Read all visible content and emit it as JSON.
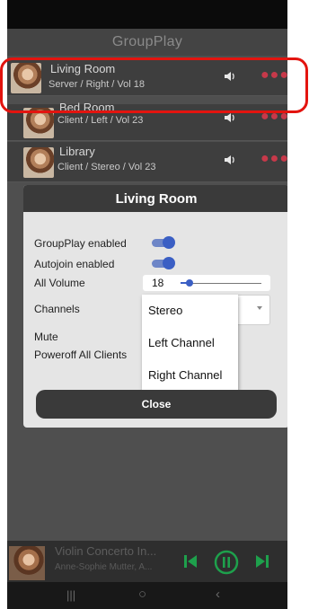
{
  "app": {
    "title": "GroupPlay"
  },
  "rooms": [
    {
      "name": "Living Room",
      "detail": "Server / Right / Vol 18"
    },
    {
      "name": "Bed Room",
      "detail": "Client / Left / Vol 23"
    },
    {
      "name": "Library",
      "detail": "Client / Stereo / Vol 23"
    }
  ],
  "dialog": {
    "title": "Living Room",
    "groupplay_label": "GroupPlay enabled",
    "groupplay_enabled": true,
    "autojoin_label": "Autojoin enabled",
    "autojoin_enabled": true,
    "volume_label": "All Volume",
    "volume_value": "18",
    "channels_label": "Channels",
    "mute_label": "Mute",
    "poweroff_label": "Poweroff All Clients",
    "close_label": "Close"
  },
  "channel_options": [
    "Stereo",
    "Left Channel",
    "Right Channel"
  ],
  "player": {
    "title": "Violin Concerto In...",
    "artist": "Anne-Sophie Mutter, A..."
  },
  "colors": {
    "accent": "#3b5fc4",
    "more_dots": "#c7394a",
    "player_controls": "#1ea04c",
    "highlight": "#e3140f"
  }
}
